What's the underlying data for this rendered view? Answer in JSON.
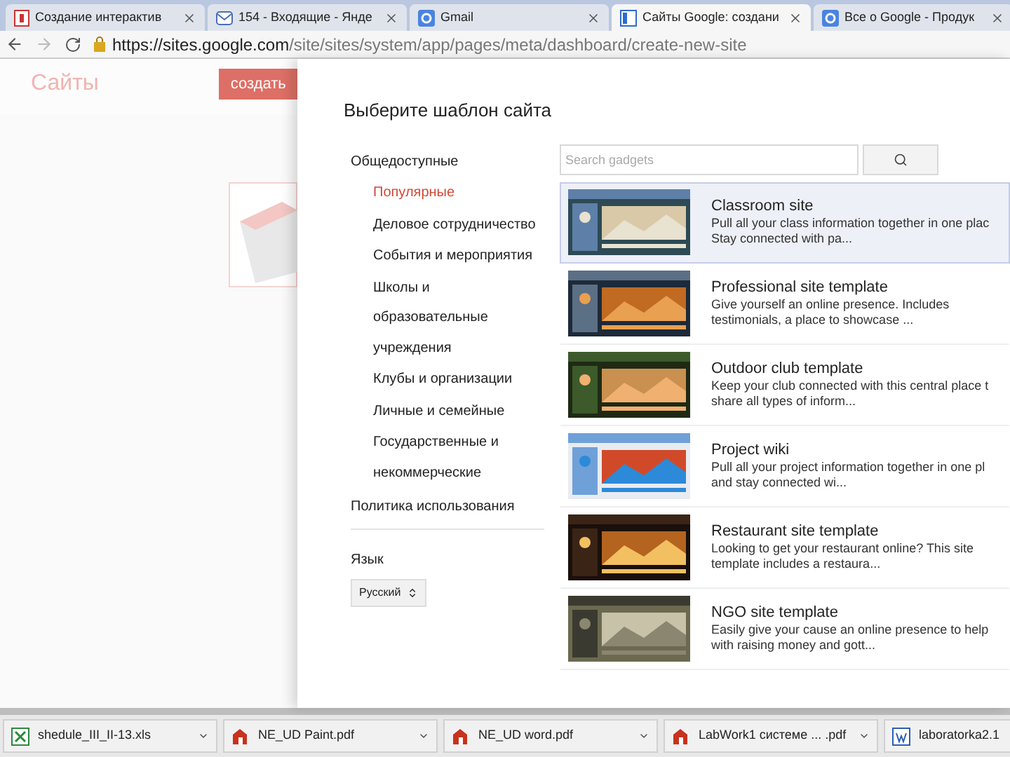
{
  "browser_tabs": [
    {
      "title": "Создание интерактив",
      "kind": "doc",
      "selected": false
    },
    {
      "title": "154 - Входящие - Янде",
      "kind": "mail",
      "selected": false
    },
    {
      "title": "Gmail",
      "kind": "g",
      "selected": false
    },
    {
      "title": "Сайты Google: создани",
      "kind": "sites",
      "selected": true
    },
    {
      "title": "Все о Google - Продук",
      "kind": "g",
      "selected": false
    }
  ],
  "address_bar": {
    "url_host": "https://sites.google.com",
    "url_path": "/site/sites/system/app/pages/meta/dashboard/create-new-site"
  },
  "background_page": {
    "logo": "Сайты",
    "create_button": "создать"
  },
  "dialog": {
    "title": "Выберите шаблон сайта",
    "categories": [
      {
        "label": "Общедоступные",
        "selected": false,
        "children": [
          {
            "label": "Популярные",
            "selected": true
          },
          {
            "label": "Деловое сотрудничество",
            "selected": false
          },
          {
            "label": "События и мероприятия",
            "selected": false
          },
          {
            "label": "Школы и образовательные учреждения",
            "selected": false
          },
          {
            "label": "Клубы и организации",
            "selected": false
          },
          {
            "label": "Личные и семейные",
            "selected": false
          },
          {
            "label": "Государственные и некоммерческие",
            "selected": false
          }
        ]
      }
    ],
    "policy_link": "Политика использования",
    "language_label": "Язык",
    "language_value": "Русский",
    "search": {
      "placeholder": "Search gadgets"
    },
    "templates": [
      {
        "title": "Classroom site",
        "description": "Pull all your class information together in one plac Stay connected with pa...",
        "selected": true
      },
      {
        "title": "Professional site template",
        "description": "Give yourself an online presence. Includes testimonials, a place to showcase ...",
        "selected": false
      },
      {
        "title": "Outdoor club template",
        "description": "Keep your club connected with this central place t share all types of inform...",
        "selected": false
      },
      {
        "title": "Project wiki",
        "description": "Pull all your project information together in one pl and stay connected wi...",
        "selected": false
      },
      {
        "title": "Restaurant site template",
        "description": "Looking to get your restaurant online? This site template includes a restaura...",
        "selected": false
      },
      {
        "title": "NGO site template",
        "description": "Easily give your cause an online presence to help with raising money and gott...",
        "selected": false
      }
    ]
  },
  "downloads": [
    {
      "name": "shedule_III_II-13.xls",
      "kind": "xls"
    },
    {
      "name": "NE_UD Paint.pdf",
      "kind": "pdf"
    },
    {
      "name": "NE_UD word.pdf",
      "kind": "pdf"
    },
    {
      "name": "LabWork1 системе ... .pdf",
      "kind": "pdf"
    },
    {
      "name": "laboratorka2.1",
      "kind": "doc"
    }
  ]
}
